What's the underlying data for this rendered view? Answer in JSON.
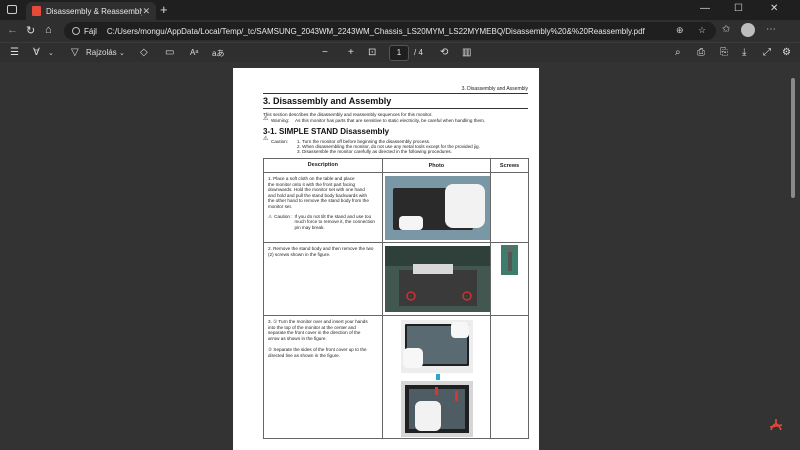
{
  "browser": {
    "tab_title": "Disassembly & Reassembly.pdf",
    "tab_close": "✕",
    "new_tab": "+",
    "url_label": "Fájl",
    "url": "C:/Users/mongu/AppData/Local/Temp/_tc/SAMSUNG_2043WM_2243WM_Chassis_LS20MYM_LS22MYMEBQ/Disassembly%20&%20Reassembly.pdf",
    "minimize": "—",
    "maximize": "☐",
    "close": "✕"
  },
  "pdf_toolbar": {
    "draw_label": "Rajzolás",
    "read_aloud": "Aᵃ",
    "page_current": "1",
    "page_total": "/ 4"
  },
  "document": {
    "running_header": "3. Disassembly and Assembly",
    "title": "3. Disassembly and Assembly",
    "intro": "This section describes the disassembly and reassembly sequences for this monitor.",
    "warning_label": "Warning:",
    "warning_text": "As this monitor has parts that are sensitive to static electricity, be careful when handling them.",
    "section_title": "3-1. SIMPLE STAND Disassembly",
    "caution_label": "Caution:",
    "caution_items": [
      "1. Turn the monitor off before beginning the disassembly process.",
      "2. When disassembling the monitor, do not use any metal tools except for the provided jig.",
      "3. Disassemble the monitor carefully as directed in the following procedures."
    ],
    "table": {
      "headers": [
        "Description",
        "Photo",
        "Screws"
      ],
      "rows": [
        {
          "lines": [
            "1.   Place a soft cloth on the table and place",
            "      the monitor onto it with the front part facing",
            "      downwards. Hold the monitor set with one hand",
            "      and hold and pull the stand body backwards with",
            "      the other hand to remove the stand body from the",
            "      monitor set."
          ],
          "caution_label": "Caution :",
          "caution_lines": [
            "If you do not tilt the stand and use too",
            "much force to remove it, the connection",
            "pin may break."
          ]
        },
        {
          "lines": [
            "2.   Remove the stand body and then remove the two",
            "      (2) screws shown in the figure."
          ]
        },
        {
          "lines": [
            "3.   ① Turn the monitor over and insert your hands",
            "      into the top of the monitor at the center and",
            "      separate the front cover in the direction of the",
            "      arrow as shown in the figure.",
            "",
            "      ② Separate the sides of the front cover up to the",
            "      directed line as shown in the figure."
          ]
        }
      ]
    }
  }
}
